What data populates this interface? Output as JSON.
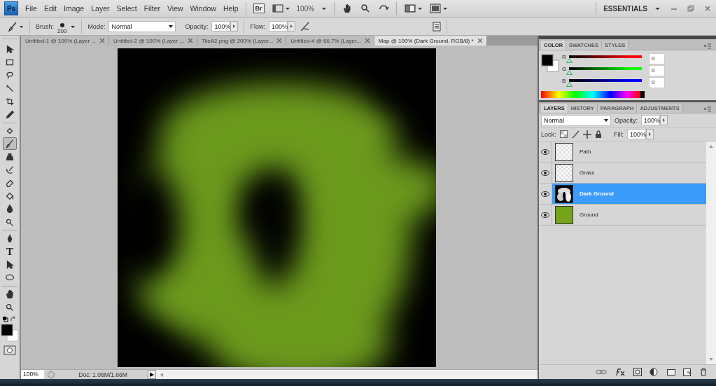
{
  "app_logo": "Ps",
  "menu": [
    "File",
    "Edit",
    "Image",
    "Layer",
    "Select",
    "Filter",
    "View",
    "Window",
    "Help"
  ],
  "appbar": {
    "bridge": "Br",
    "zoom": "100%",
    "workspace": "ESSENTIALS"
  },
  "options": {
    "brush_label": "Brush:",
    "brush_size": "200",
    "mode_label": "Mode:",
    "mode": "Normal",
    "opacity_label": "Opacity:",
    "opacity": "100%",
    "flow_label": "Flow:",
    "flow": "100%"
  },
  "doc_tabs": [
    {
      "label": "Untitled-1 @ 100% (Layer ...",
      "selected": false
    },
    {
      "label": "Untitled-2 @ 100% (Layer ...",
      "selected": false
    },
    {
      "label": "TileA2.png @ 200% (Layer...",
      "selected": false
    },
    {
      "label": "Untitled-4 @ 66.7% (Layer...",
      "selected": false
    },
    {
      "label": "Map @ 100% (Dark Ground, RGB/8) *",
      "selected": true
    }
  ],
  "tool_groups": [
    [
      {
        "kind": "move",
        "selected": false
      },
      {
        "kind": "marquee",
        "selected": false
      },
      {
        "kind": "lasso",
        "selected": false
      },
      {
        "kind": "wand",
        "selected": false
      },
      {
        "kind": "crop",
        "selected": false
      },
      {
        "kind": "eyedropper",
        "selected": false
      }
    ],
    [
      {
        "kind": "heal",
        "selected": false
      },
      {
        "kind": "brush",
        "selected": true
      },
      {
        "kind": "stamp",
        "selected": false
      },
      {
        "kind": "history",
        "selected": false
      },
      {
        "kind": "eraser",
        "selected": false
      },
      {
        "kind": "bucket",
        "selected": false
      },
      {
        "kind": "blur",
        "selected": false
      },
      {
        "kind": "dodge",
        "selected": false
      }
    ],
    [
      {
        "kind": "pen",
        "selected": false
      },
      {
        "kind": "type",
        "glyph": "T",
        "selected": false
      },
      {
        "kind": "select",
        "selected": false
      },
      {
        "kind": "shape",
        "selected": false
      }
    ],
    [
      {
        "kind": "hand",
        "selected": false
      },
      {
        "kind": "zoom",
        "selected": false
      }
    ]
  ],
  "color_panel": {
    "tabs": [
      {
        "label": "COLOR",
        "selected": true
      },
      {
        "label": "SWATCHES",
        "selected": false
      },
      {
        "label": "STYLES",
        "selected": false
      }
    ],
    "channels": [
      {
        "name": "R",
        "value": "0",
        "level": 0,
        "color": "#ff0000"
      },
      {
        "name": "G",
        "value": "0",
        "level": 0,
        "color": "#00ff00"
      },
      {
        "name": "B",
        "value": "0",
        "level": 0,
        "color": "#0000ff"
      }
    ]
  },
  "layers_panel": {
    "tabs": [
      {
        "label": "LAYERS",
        "selected": true
      },
      {
        "label": "HISTORY",
        "selected": false
      },
      {
        "label": "PARAGRAPH",
        "selected": false
      },
      {
        "label": "ADJUSTMENTS",
        "selected": false
      }
    ],
    "blend_mode": "Normal",
    "opacity_label": "Opacity:",
    "opacity": "100%",
    "lock_label": "Lock:",
    "fill_label": "Fill:",
    "fill": "100%",
    "layers": [
      {
        "name": "Path",
        "kind": "transparent",
        "visible": true,
        "selected": false
      },
      {
        "name": "Grass",
        "kind": "transparent",
        "visible": true,
        "selected": false
      },
      {
        "name": "Dark Ground",
        "kind": "mask",
        "visible": true,
        "selected": true
      },
      {
        "name": "Ground",
        "kind": "fill",
        "color": "#76a31c",
        "visible": true,
        "selected": false
      }
    ]
  },
  "status_bar": {
    "zoom": "100%",
    "doc": "Doc: 1.06M/1.66M",
    "more": "▶"
  }
}
